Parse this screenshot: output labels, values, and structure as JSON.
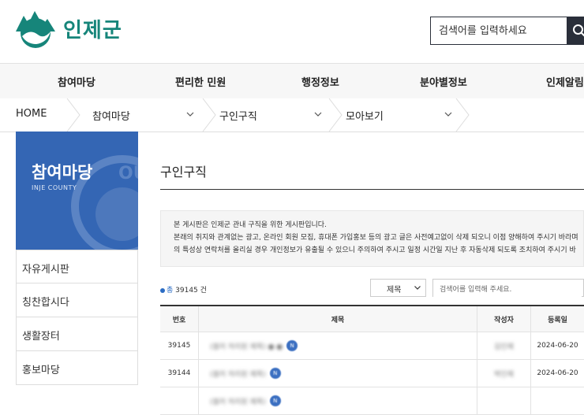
{
  "header": {
    "logo_text": "인제군",
    "search_placeholder": "검색어를 입력하세요",
    "brand_color": "#16857a"
  },
  "gnb": [
    "참여마당",
    "편리한 민원",
    "행정정보",
    "분야별정보",
    "인제알림"
  ],
  "breadcrumb": {
    "home": "HOME",
    "level1": "참여마당",
    "level2": "구인구직",
    "level3": "모아보기"
  },
  "sidebar": {
    "title": "참여마당",
    "subtitle": "INJE COUNTY",
    "watermark": "OUN",
    "items": [
      "자유게시판",
      "칭찬합시다",
      "생활장터",
      "홍보마당"
    ]
  },
  "main": {
    "title": "구인구직",
    "notice": [
      "본 게시판은 인제군 관내 구직을 위한 게시판입니다.",
      "본래의 취지와 관계없는 광고, 온라인 회원 모집, 휴대폰 가입홍보 등의 광고 글은 사전예고없이 삭제 되오니 이점 양해하여 주시기 바라며",
      "의 특성상 연락처를 올리실 경우 개인정보가 유출될 수 있으니 주의하여 주시고 일정 시간일 지난 후 자동삭제 되도록 조치하여 주시기 바"
    ],
    "count_prefix": "총",
    "count_value": "39145",
    "count_suffix": "건",
    "select_value": "제목",
    "keyword_placeholder": "검색어를 입력해 주세요."
  },
  "table": {
    "headers": [
      "번호",
      "제목",
      "작성자",
      "등록일"
    ],
    "rows": [
      {
        "no": "39145",
        "title": "(블러 처리된 제목) ● ●",
        "author": "김인제",
        "date": "2024-06-20",
        "badge": "N"
      },
      {
        "no": "39144",
        "title": "(블러 처리된 제목)",
        "author": "박인제",
        "date": "2024-06-20",
        "badge": "N"
      },
      {
        "no": "",
        "title": "(블러 처리된 제목)",
        "author": "",
        "date": "",
        "badge": "N"
      }
    ]
  }
}
